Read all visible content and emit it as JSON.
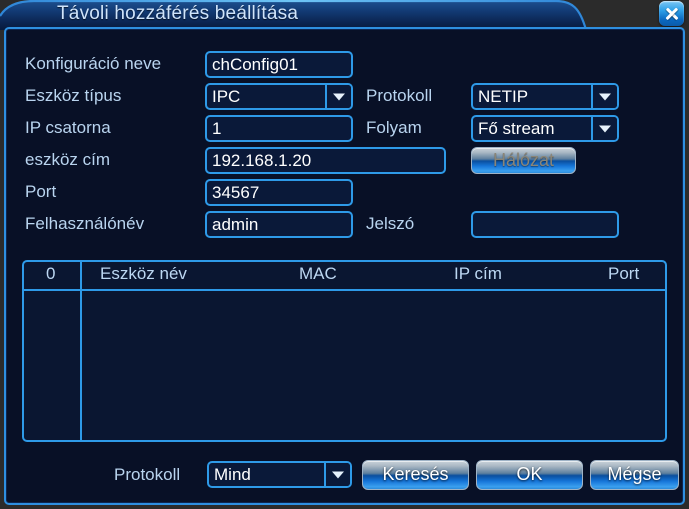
{
  "window": {
    "title": "Távoli hozzáférés beállítása",
    "close_icon": "close-icon",
    "accent_color": "#2e9ae8",
    "background_color": "#081026",
    "label_color": "#b9d4ef"
  },
  "form": {
    "config_name": {
      "label": "Konfiguráció neve",
      "value": "chConfig01"
    },
    "device_type": {
      "label": "Eszköz típus",
      "value": "IPC"
    },
    "protocol": {
      "label": "Protokoll",
      "value": "NETIP"
    },
    "ip_channel": {
      "label": "IP csatorna",
      "value": "1"
    },
    "stream": {
      "label": "Folyam",
      "value": "Fő stream"
    },
    "device_addr": {
      "label": "eszköz cím",
      "value": "192.168.1.20"
    },
    "network_button": {
      "label": "Hálózat",
      "enabled": false
    },
    "port": {
      "label": "Port",
      "value": "34567"
    },
    "username": {
      "label": "Felhasználónév",
      "value": "admin"
    },
    "password": {
      "label": "Jelszó",
      "value": ""
    }
  },
  "table": {
    "columns": [
      "0",
      "Eszköz név",
      "MAC",
      "IP cím",
      "Port"
    ],
    "rows": []
  },
  "bottom": {
    "protocol_label": "Protokoll",
    "protocol_value": "Mind",
    "search_button": "Keresés",
    "ok_button": "OK",
    "cancel_button": "Mégse"
  }
}
